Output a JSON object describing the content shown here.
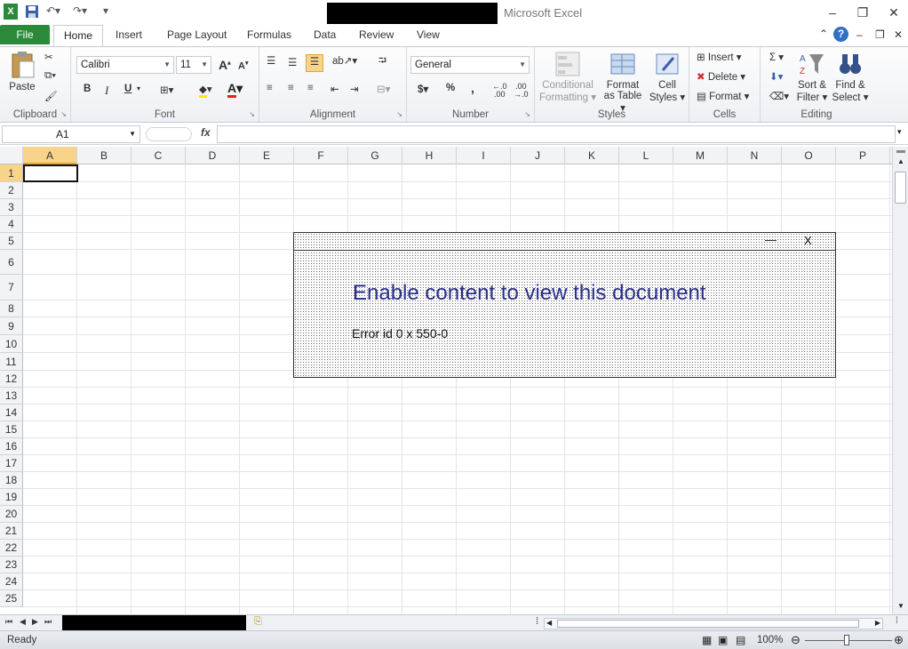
{
  "app": {
    "title": "Microsoft Excel"
  },
  "ribbon_tabs": {
    "file": "File",
    "home": "Home",
    "insert": "Insert",
    "page_layout": "Page Layout",
    "formulas": "Formulas",
    "data": "Data",
    "review": "Review",
    "view": "View"
  },
  "clipboard": {
    "paste": "Paste",
    "label": "Clipboard"
  },
  "font": {
    "name": "Calibri",
    "size": "11",
    "label": "Font",
    "bold": "B",
    "italic": "I",
    "underline": "U",
    "grow": "A",
    "shrink": "A",
    "color": "A"
  },
  "alignment": {
    "label": "Alignment"
  },
  "number": {
    "format": "General",
    "label": "Number",
    "currency": "$",
    "percent": "%",
    "comma": ",",
    "inc_dec": ".0\n.00",
    "dec_dec": ".00\n.0"
  },
  "styles": {
    "conditional": "Conditional",
    "conditional2": "Formatting",
    "format_table": "Format",
    "format_table2": "as Table",
    "cell_styles": "Cell",
    "cell_styles2": "Styles",
    "label": "Styles"
  },
  "cells": {
    "insert": "Insert",
    "delete": "Delete",
    "format": "Format",
    "label": "Cells"
  },
  "editing": {
    "sigma": "Σ",
    "sort": "Sort &",
    "sort2": "Filter",
    "find": "Find &",
    "find2": "Select",
    "label": "Editing"
  },
  "formula_bar": {
    "name_box": "A1",
    "fx": "fx"
  },
  "columns": [
    "A",
    "B",
    "C",
    "D",
    "E",
    "F",
    "G",
    "H",
    "I",
    "J",
    "K",
    "L",
    "M",
    "N",
    "O",
    "P"
  ],
  "rows": [
    "1",
    "2",
    "3",
    "4",
    "5",
    "6",
    "7",
    "8",
    "9",
    "10",
    "11",
    "12",
    "13",
    "14",
    "15",
    "16",
    "17",
    "18",
    "19",
    "20",
    "21",
    "22",
    "23",
    "24",
    "25"
  ],
  "dialog": {
    "minimize": "—",
    "close": "X",
    "heading": "Enable content to view this document",
    "error": "Error id 0 x 550-0"
  },
  "status": {
    "ready": "Ready",
    "zoom": "100%"
  },
  "colors": {
    "file_tab": "#2a8a3a",
    "dialog_heading": "#2a2f88",
    "selected_header": "#f7d48a"
  }
}
